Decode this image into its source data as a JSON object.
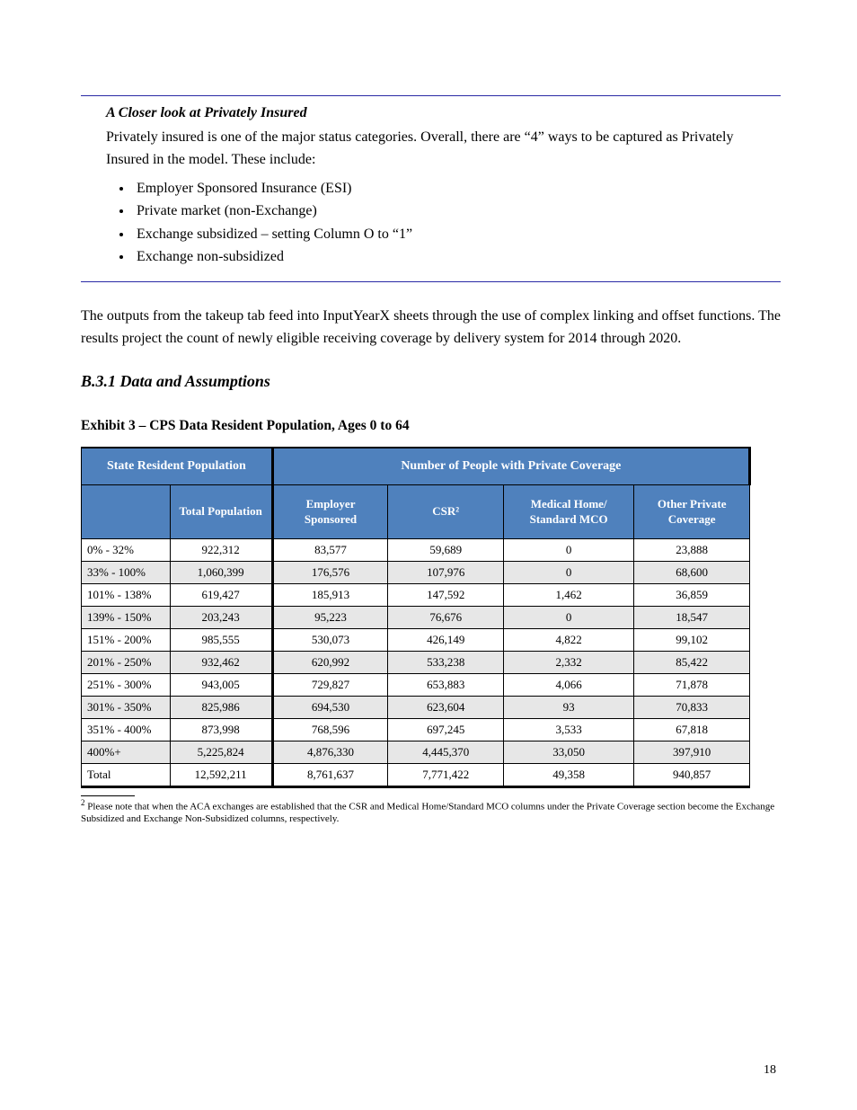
{
  "callout": {
    "title": "A Closer look at Privately Insured",
    "body_pre": "Privately insured is one of the major status categories. Overall, there are ",
    "body_count": "4",
    "body_mid": " ways to be captured as Privately Insured in the model. These include:",
    "bullets": [
      "Employer Sponsored Insurance (ESI)",
      "Private market (non-Exchange)",
      "Exchange subsidized – setting Column O to “1”",
      "Exchange non-subsidized"
    ]
  },
  "paragraph": "The outputs from the takeup tab feed into InputYearX sheets through the use of complex linking and offset functions. The results project the count of newly eligible receiving coverage by delivery system for 2014 through 2020.",
  "section_heading": "B.3.1 Data and Assumptions",
  "exhibit": {
    "heading": "Exhibit 3 – CPS Data Resident Population, Ages 0 to 64",
    "top_headers": [
      "State Resident Population",
      "Number of People with Private Coverage"
    ],
    "sub_headers": [
      "",
      "Total Population",
      "Employer Sponsored",
      "CSR²",
      "Medical Home/ Standard MCO",
      "Other Private Coverage"
    ],
    "rows": [
      {
        "label": "0% - 32%",
        "values": [
          "922,312",
          "83,577",
          "59,689",
          "0",
          "23,888"
        ]
      },
      {
        "label": "33% - 100%",
        "values": [
          "1,060,399",
          "176,576",
          "107,976",
          "0",
          "68,600"
        ]
      },
      {
        "label": "101% - 138%",
        "values": [
          "619,427",
          "185,913",
          "147,592",
          "1,462",
          "36,859"
        ]
      },
      {
        "label": "139% - 150%",
        "values": [
          "203,243",
          "95,223",
          "76,676",
          "0",
          "18,547"
        ]
      },
      {
        "label": "151% - 200%",
        "values": [
          "985,555",
          "530,073",
          "426,149",
          "4,822",
          "99,102"
        ]
      },
      {
        "label": "201% - 250%",
        "values": [
          "932,462",
          "620,992",
          "533,238",
          "2,332",
          "85,422"
        ]
      },
      {
        "label": "251% - 300%",
        "values": [
          "943,005",
          "729,827",
          "653,883",
          "4,066",
          "71,878"
        ]
      },
      {
        "label": "301% - 350%",
        "values": [
          "825,986",
          "694,530",
          "623,604",
          "93",
          "70,833"
        ]
      },
      {
        "label": "351% - 400%",
        "values": [
          "873,998",
          "768,596",
          "697,245",
          "3,533",
          "67,818"
        ]
      },
      {
        "label": "400%+",
        "values": [
          "5,225,824",
          "4,876,330",
          "4,445,370",
          "33,050",
          "397,910"
        ]
      },
      {
        "label": "Total",
        "values": [
          "12,592,211",
          "8,761,637",
          "7,771,422",
          "49,358",
          "940,857"
        ],
        "last": true
      }
    ]
  },
  "footnote": {
    "marker": "2",
    "text": "Please note that when the ACA exchanges are established that the CSR and Medical Home/Standard MCO columns under the Private Coverage section become the Exchange Subsidized and Exchange Non-Subsidized columns, respectively."
  },
  "page_number": "18"
}
